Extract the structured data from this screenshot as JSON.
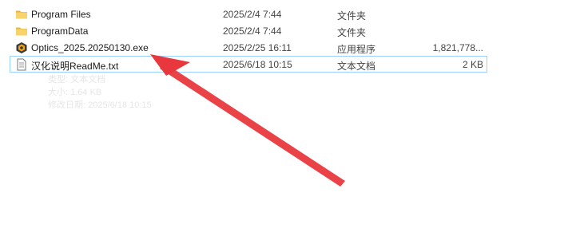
{
  "files": [
    {
      "name": "Program Files",
      "date": "2025/2/4 7:44",
      "type": "文件夹",
      "size": "",
      "icon": "folder-icon"
    },
    {
      "name": "ProgramData",
      "date": "2025/2/4 7:44",
      "type": "文件夹",
      "size": "",
      "icon": "folder-icon"
    },
    {
      "name": "Optics_2025.20250130.exe",
      "date": "2025/2/25 16:11",
      "type": "应用程序",
      "size": "1,821,778...",
      "icon": "app-exe-icon"
    },
    {
      "name": "汉化说明ReadMe.txt",
      "date": "2025/6/18 10:15",
      "type": "文本文档",
      "size": "2 KB",
      "icon": "text-file-icon"
    }
  ],
  "tooltip": {
    "line1": "类型: 文本文档",
    "line2": "大小: 1.64 KB",
    "line3": "修改日期: 2025/6/18 10:15"
  },
  "colors": {
    "folder": "#f5c542",
    "selection_border": "#99d1ff",
    "arrow": "#e8383d"
  }
}
